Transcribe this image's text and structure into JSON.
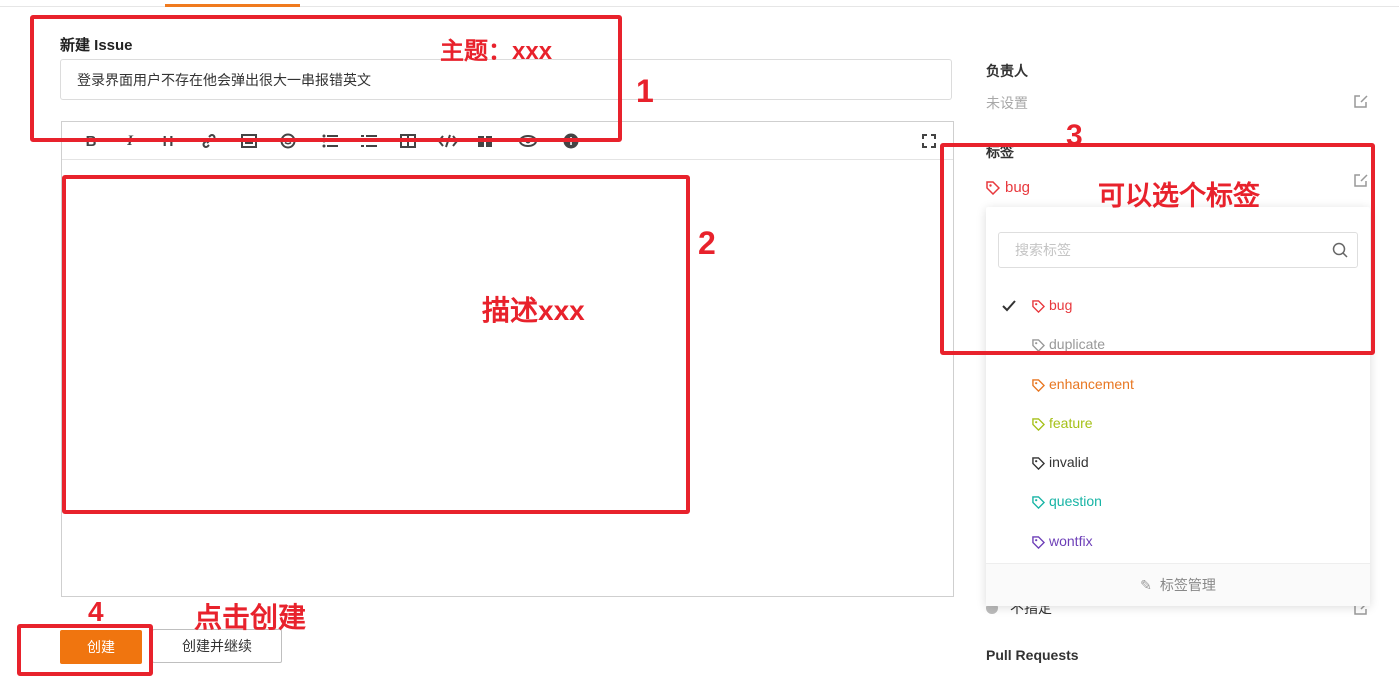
{
  "form": {
    "title": "新建 Issue",
    "subject_value": "登录界面用户不存在他会弹出很大一串报错英文",
    "toolbar": [
      {
        "name": "bold-icon",
        "glyph": "B"
      },
      {
        "name": "italic-icon",
        "glyph": "I"
      },
      {
        "name": "heading-icon",
        "glyph": "H"
      },
      {
        "name": "link-icon",
        "glyph": "🔗"
      },
      {
        "name": "image-icon",
        "glyph": "▣"
      },
      {
        "name": "emoji-icon",
        "glyph": "☺"
      },
      {
        "name": "unordered-list-icon",
        "glyph": "≡"
      },
      {
        "name": "ordered-list-icon",
        "glyph": "≣"
      },
      {
        "name": "table-icon",
        "glyph": "▦"
      },
      {
        "name": "code-icon",
        "glyph": "</>"
      },
      {
        "name": "quote-icon",
        "glyph": "❝"
      },
      {
        "name": "preview-icon",
        "glyph": "◉"
      },
      {
        "name": "help-icon",
        "glyph": "?"
      }
    ],
    "create_label": "创建",
    "create_continue_label": "创建并继续"
  },
  "sidebar": {
    "assignee_heading": "负责人",
    "assignee_value": "未设置",
    "labels_heading": "标签",
    "selected_label": "bug",
    "milestone_value": "不指定",
    "pull_requests_heading": "Pull Requests"
  },
  "label_dropdown": {
    "search_placeholder": "搜索标签",
    "items": [
      {
        "name": "bug",
        "color": "#e8383d",
        "checked": true
      },
      {
        "name": "duplicate",
        "color": "#999999",
        "checked": false
      },
      {
        "name": "enhancement",
        "color": "#e87722",
        "checked": false
      },
      {
        "name": "feature",
        "color": "#a6c11a",
        "checked": false
      },
      {
        "name": "invalid",
        "color": "#333333",
        "checked": false
      },
      {
        "name": "question",
        "color": "#18b4a5",
        "checked": false
      },
      {
        "name": "wontfix",
        "color": "#6d3fb8",
        "checked": false
      }
    ],
    "footer": "标签管理"
  },
  "annotations": {
    "subject_note": "主题：xxx",
    "num1": "1",
    "desc_note": "描述xxx",
    "num2": "2",
    "num3": "3",
    "label_note": "可以选个标签",
    "num4": "4",
    "click_note": "点击创建"
  },
  "colors": {
    "accent": "#f0750f",
    "annotation": "#e8222c"
  }
}
